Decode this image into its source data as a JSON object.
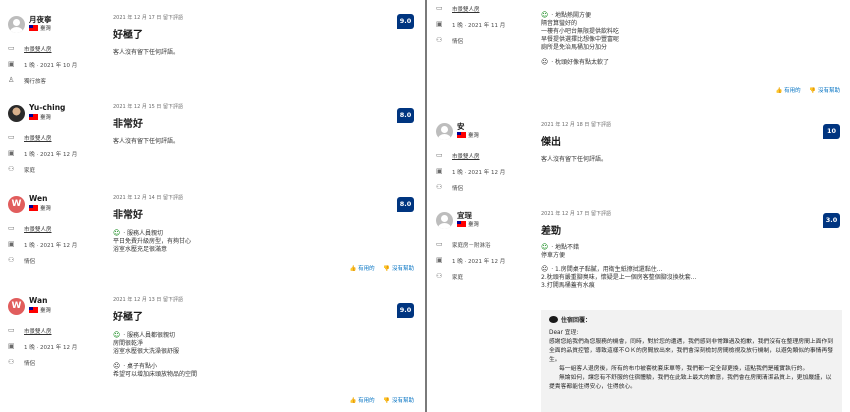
{
  "left": {
    "reviews": [
      {
        "name": "月夜寧",
        "country": "臺灣",
        "avatar": "grey",
        "room": "市景雙人房",
        "stay": "1 晚 · 2021 年 10 月",
        "group": "獨行旅客",
        "date": "2021 年 12 月 17 日 留下評語",
        "title": "好極了",
        "score": "9.0",
        "text": "客人沒有留下任何評語。"
      },
      {
        "name": "Yu-ching",
        "country": "臺灣",
        "avatar": "photo",
        "room": "市景雙人房",
        "stay": "1 晚 · 2021 年 12 月",
        "group": "家庭",
        "date": "2021 年 12 月 15 日 留下評語",
        "title": "非常好",
        "score": "8.0",
        "text": "客人沒有留下任何評語。"
      },
      {
        "name": "Wen",
        "country": "臺灣",
        "avatar": "W",
        "room": "市景雙人房",
        "stay": "1 晚 · 2021 年 12 月",
        "group": "情侶",
        "date": "2021 年 12 月 14 日 留下評語",
        "title": "非常好",
        "score": "8.0",
        "pos": [
          "服務人員親切",
          "平日免費升級房型，有夠甘心",
          "浴室水壓充足很滿意"
        ]
      },
      {
        "name": "Wan",
        "country": "臺灣",
        "avatar": "W",
        "room": "市景雙人房",
        "stay": "1 晚 · 2021 年 12 月",
        "group": "情侶",
        "date": "2021 年 12 月 13 日 留下評語",
        "title": "好極了",
        "score": "9.0",
        "pos": [
          "服務人員都很親切",
          "房間很乾淨",
          "浴室水壓很大洗澡很舒服"
        ],
        "neg": [
          "桌子有點小",
          "希望可以增加床頭放物品的空間"
        ]
      }
    ],
    "helpful_label": "有用的",
    "not_helpful_label": "沒有幫助"
  },
  "right": {
    "top": {
      "room": "市景雙人房",
      "stay": "1 晚 · 2021 年 11 月",
      "group": "情侶",
      "pos": [
        "地點熱鬧方便",
        "隔音算蠻好的",
        "一樓有小吧台無限提供飲料吃",
        "早餐提供選擇比想像中豐富呢",
        "廁所是免治馬桶加分加分"
      ],
      "neg": [
        "枕頭好像有點太軟了"
      ]
    },
    "helpful_label": "有用的",
    "not_helpful_label": "沒有幫助",
    "reviews": [
      {
        "name": "安",
        "country": "臺灣",
        "room": "市景雙人房",
        "stay": "1 晚 · 2021 年 12 月",
        "group": "情侶",
        "date": "2021 年 12 月 18 日 留下評語",
        "title": "傑出",
        "score": "10",
        "text": "客人沒有留下任何評語。"
      },
      {
        "name": "宜珵",
        "country": "臺灣",
        "room": "家庭房－附淋浴",
        "stay": "1 晚 · 2021 年 12 月",
        "group": "家庭",
        "date": "2021 年 12 月 17 日 留下評語",
        "title": "差勁",
        "score": "3.0",
        "pos": [
          "地點不錯",
          "停車方便"
        ],
        "neg": [
          "1.房間桌子黏膩，用衛生紙擦拭還黏住...",
          "2.枕頭有嚴重腳臭味，懷疑是上一個房客整個腳沒換枕套...",
          "3.打開馬桶蓋有水痕"
        ]
      }
    ],
    "reply": {
      "heading": "住宿回覆：",
      "salutation": "Dear 宜珵:",
      "p1": "感謝您給我們為您服務的機會，同時，對於您的遭遇，我們感到非常難過及抱歉，我們沒有在整理房間上面作到全面的品質控管，導致這樣不ＯＫ的房間放出來，我們會深刻檢討房間檢視及放行機制，以避免類似的事情再發生。",
      "p2": "每一組客人退房後，所有的布巾被套枕套床單等，我們都一定全部更換，這點我們是確實執行的。",
      "p3": "無論如何，讓您有不舒服的住宿體驗，我們在此致上最大的歉意，我們會在房間清潔品質上，更加嚴謹，以提貴客都能住得安心，住得放心。"
    }
  }
}
